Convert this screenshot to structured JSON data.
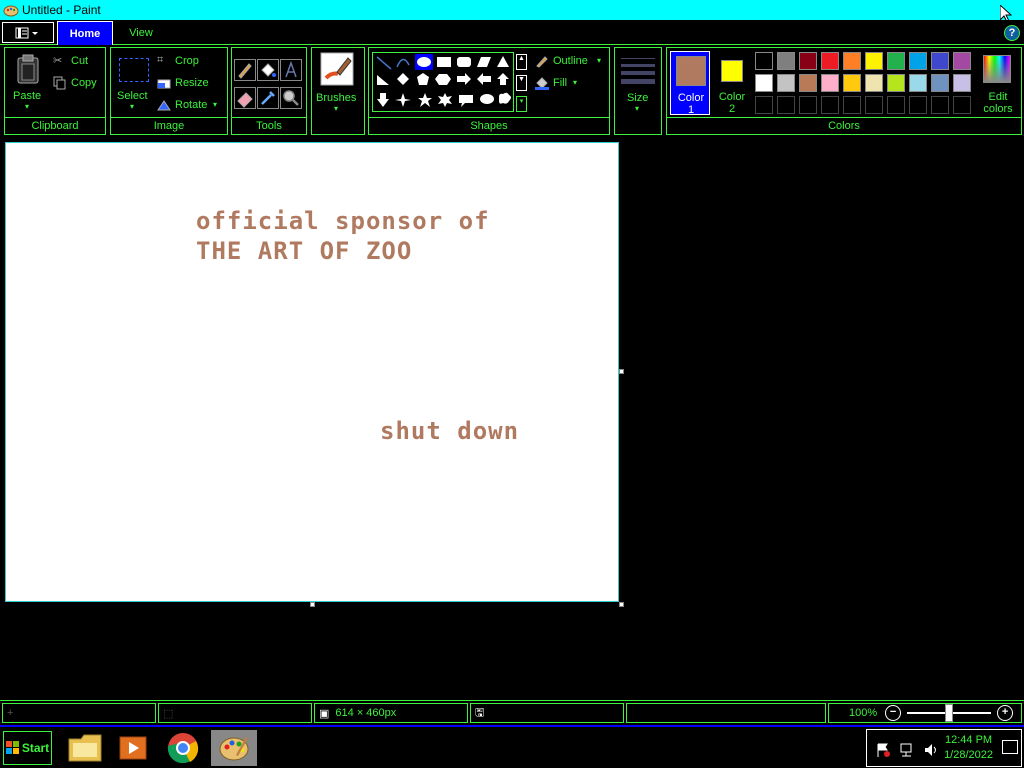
{
  "window": {
    "title": "Untitled - Paint"
  },
  "tabs": [
    {
      "label": "Home",
      "active": true
    },
    {
      "label": "View",
      "active": false
    }
  ],
  "ribbon": {
    "clipboard": {
      "group_label": "Clipboard",
      "paste": "Paste",
      "cut": "Cut",
      "copy": "Copy"
    },
    "image": {
      "group_label": "Image",
      "select": "Select",
      "crop": "Crop",
      "resize": "Resize",
      "rotate": "Rotate"
    },
    "tools": {
      "group_label": "Tools"
    },
    "brushes": {
      "label": "Brushes"
    },
    "shapes": {
      "group_label": "Shapes",
      "outline": "Outline",
      "fill": "Fill"
    },
    "size": {
      "label": "Size"
    },
    "colors": {
      "group_label": "Colors",
      "color1_label": "Color 1",
      "color2_label": "Color 2",
      "edit_colors": "Edit colors",
      "color1": "#b07a60",
      "color2": "#ffff00",
      "palette_row1": [
        "#000000",
        "#7f7f7f",
        "#880015",
        "#ed1c24",
        "#ff7f27",
        "#fff200",
        "#22b14c",
        "#00a2e8",
        "#3f48cc",
        "#a349a4"
      ],
      "palette_row2": [
        "#ffffff",
        "#c3c3c3",
        "#b97a57",
        "#ffaec9",
        "#ffc90e",
        "#efe4b0",
        "#b5e61d",
        "#99d9ea",
        "#7092be",
        "#c8bfe7"
      ],
      "palette_row3": [
        "#000000",
        "#000000",
        "#000000",
        "#000000",
        "#000000",
        "#000000",
        "#000000",
        "#000000",
        "#000000",
        "#000000"
      ]
    }
  },
  "canvas": {
    "line1": "official sponsor of",
    "line2": "THE ART OF ZOO",
    "line3": "shut down",
    "text_color": "#b07a60"
  },
  "statusbar": {
    "dimensions": "614 × 460px",
    "zoom": "100%"
  },
  "taskbar": {
    "start": "Start",
    "time": "12:44 PM",
    "date": "1/28/2022"
  }
}
